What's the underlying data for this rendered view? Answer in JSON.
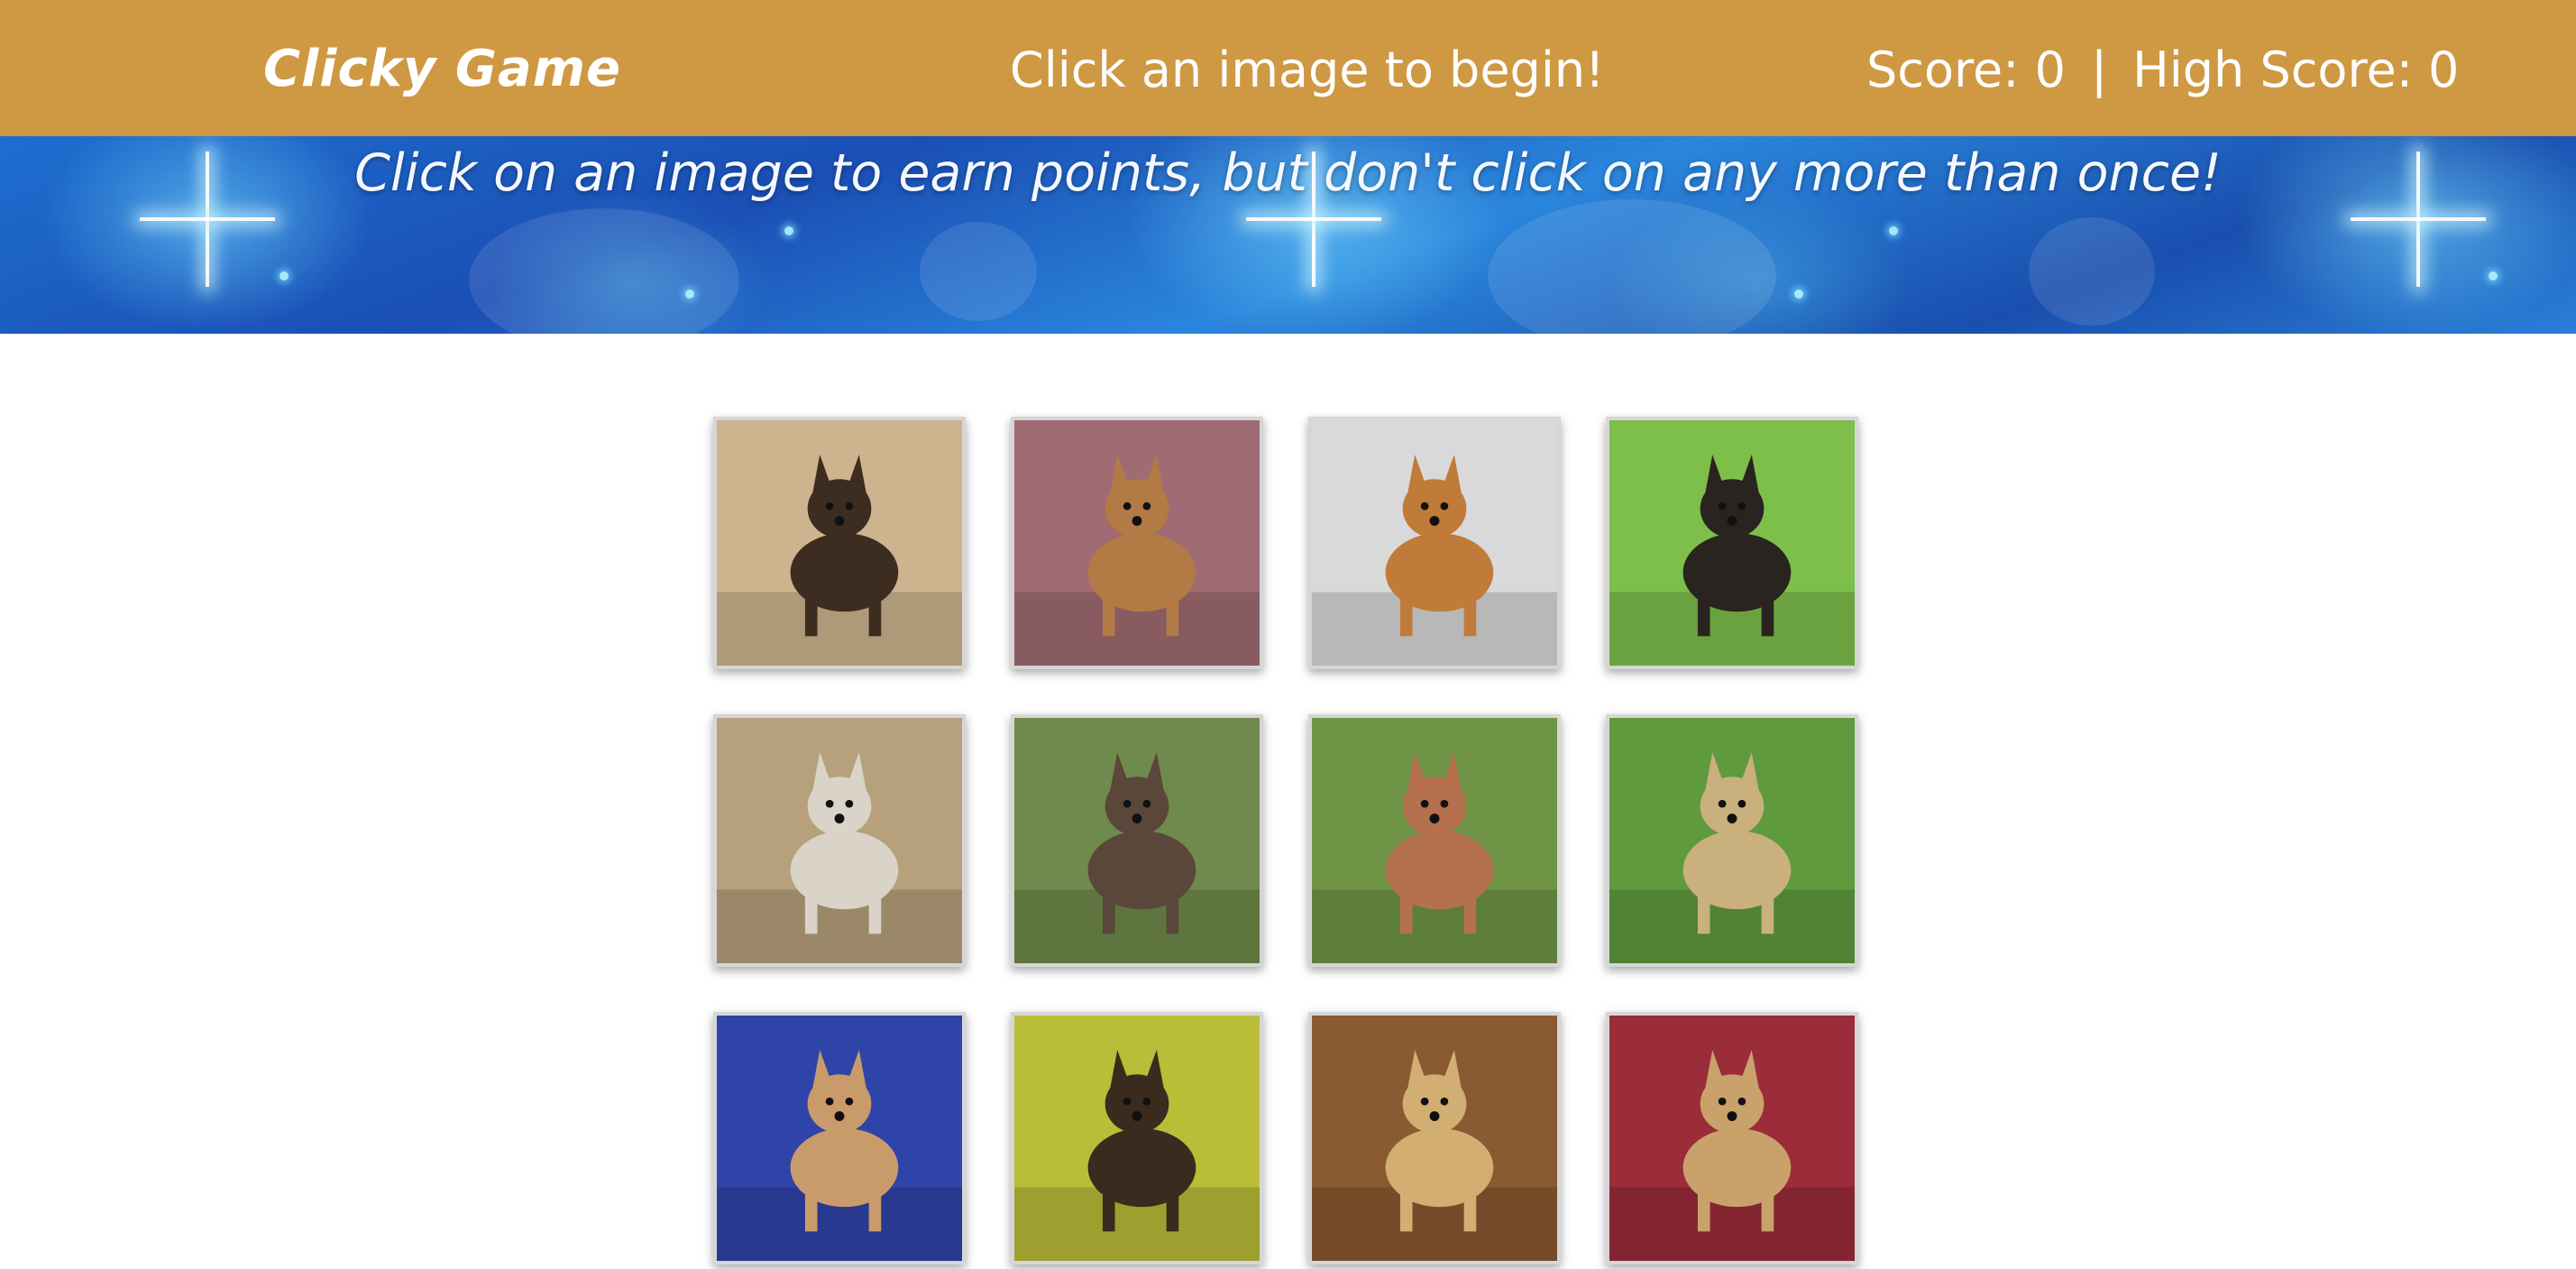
{
  "navbar": {
    "brand": "Clicky Game",
    "status": "Click an image to begin!",
    "score_label": "Score: 0",
    "separator": "|",
    "high_score_label": "High Score: 0"
  },
  "banner": {
    "instructions": "Click on an image to earn points, but don't click on any more than once!"
  },
  "colors": {
    "navbar": "#cf9842",
    "banner": "#1b4fb5"
  },
  "cards": [
    {
      "name": "shiba-inu-card-image",
      "bg": "#cdb48e",
      "fg": "#3d2d20"
    },
    {
      "name": "puppy-in-leaves-card-image",
      "bg": "#a06b72",
      "fg": "#b27a44"
    },
    {
      "name": "akita-card-image",
      "bg": "#d9d9d9",
      "fg": "#c07a3a"
    },
    {
      "name": "chihuahua-card-image",
      "bg": "#7dbf4a",
      "fg": "#2a2420"
    },
    {
      "name": "cairn-terrier-card-image",
      "bg": "#b7a07c",
      "fg": "#d9d3c8"
    },
    {
      "name": "poodle-on-hillside-card-image",
      "bg": "#6f8a4c",
      "fg": "#5b463a"
    },
    {
      "name": "red-retriever-card-image",
      "bg": "#6f9446",
      "fg": "#b5714d"
    },
    {
      "name": "mastiff-card-image",
      "bg": "#5f9a3e",
      "fg": "#c9b07c"
    },
    {
      "name": "greyhound-on-couch-card-image",
      "bg": "#2f44a8",
      "fg": "#c99b6b"
    },
    {
      "name": "german-shepherd-card-image",
      "bg": "#b9bd38",
      "fg": "#3b2a1e"
    },
    {
      "name": "briard-card-image",
      "bg": "#8a5a32",
      "fg": "#d2ae72"
    },
    {
      "name": "afghan-hound-card-image",
      "bg": "#9b2c3a",
      "fg": "#c9a26b"
    }
  ]
}
